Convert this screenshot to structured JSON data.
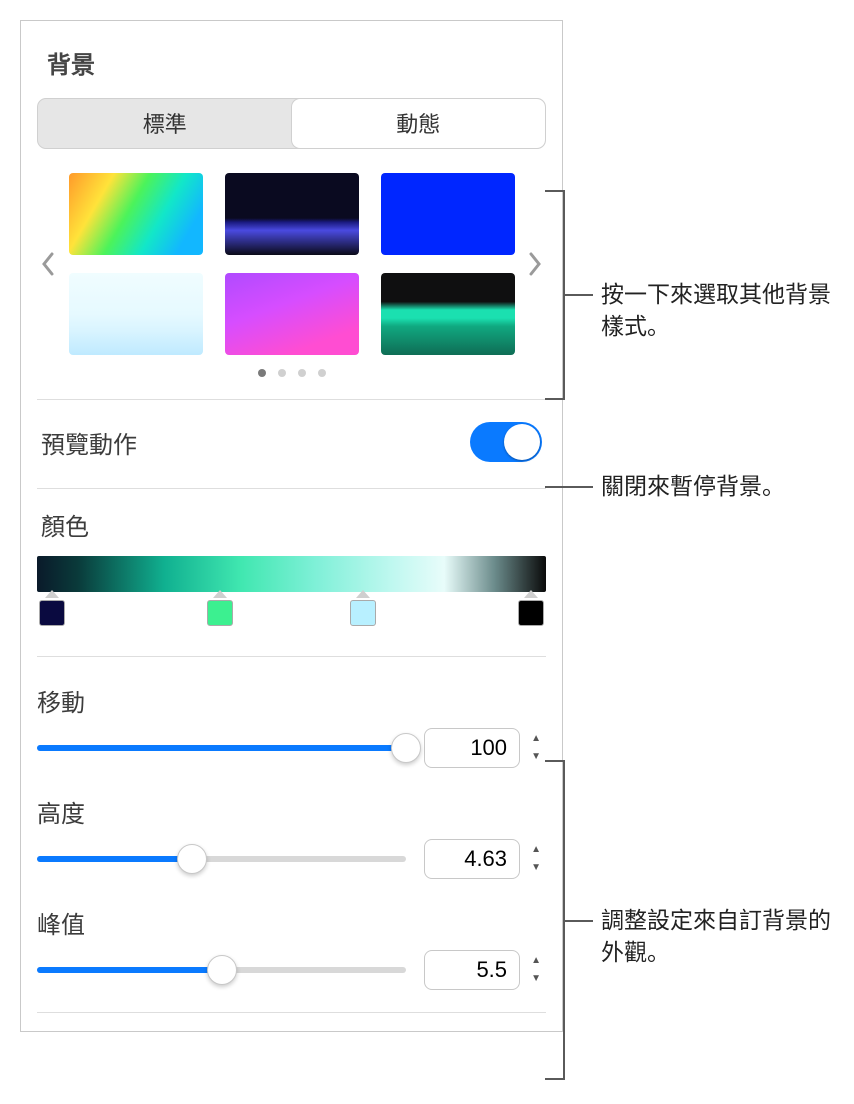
{
  "section": {
    "title": "背景"
  },
  "tabs": {
    "standard": "標準",
    "dynamic": "動態"
  },
  "preview": {
    "label": "預覽動作"
  },
  "color": {
    "label": "顏色",
    "stops": [
      "#0a0a40",
      "#3cf090",
      "#b8f0ff",
      "#000000"
    ]
  },
  "sliders": {
    "move": {
      "label": "移動",
      "value": "100",
      "pct": 100
    },
    "height": {
      "label": "高度",
      "value": "4.63",
      "pct": 42
    },
    "peak": {
      "label": "峰值",
      "value": "5.5",
      "pct": 50
    }
  },
  "callouts": {
    "styles": "按一下來選取其他背景樣式。",
    "pause": "關閉來暫停背景。",
    "customize": "調整設定來自訂背景的外觀。"
  }
}
